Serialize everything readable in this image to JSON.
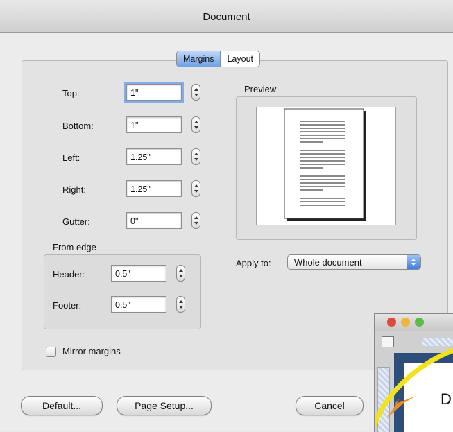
{
  "window": {
    "title": "Document"
  },
  "tabs": [
    {
      "label": "Margins",
      "selected": true
    },
    {
      "label": "Layout",
      "selected": false
    }
  ],
  "margins": {
    "top": {
      "label": "Top:",
      "value": "1\""
    },
    "bottom": {
      "label": "Bottom:",
      "value": "1\""
    },
    "left": {
      "label": "Left:",
      "value": "1.25\""
    },
    "right": {
      "label": "Right:",
      "value": "1.25\""
    },
    "gutter": {
      "label": "Gutter:",
      "value": "0\""
    }
  },
  "from_edge": {
    "title": "From edge",
    "header": {
      "label": "Header:",
      "value": "0.5\""
    },
    "footer": {
      "label": "Footer:",
      "value": "0.5\""
    }
  },
  "preview": {
    "title": "Preview"
  },
  "apply_to": {
    "label": "Apply to:",
    "value": "Whole document"
  },
  "mirror_margins": {
    "label": "Mirror margins",
    "checked": false
  },
  "buttons": {
    "default": "Default...",
    "page_setup": "Page Setup...",
    "cancel": "Cancel"
  },
  "background_window": {
    "annotation_letter": "D"
  },
  "colors": {
    "accent": "#6fa2e9",
    "annotation_outline": "#f2e21a",
    "annotation_arrow": "#f08a1c"
  }
}
